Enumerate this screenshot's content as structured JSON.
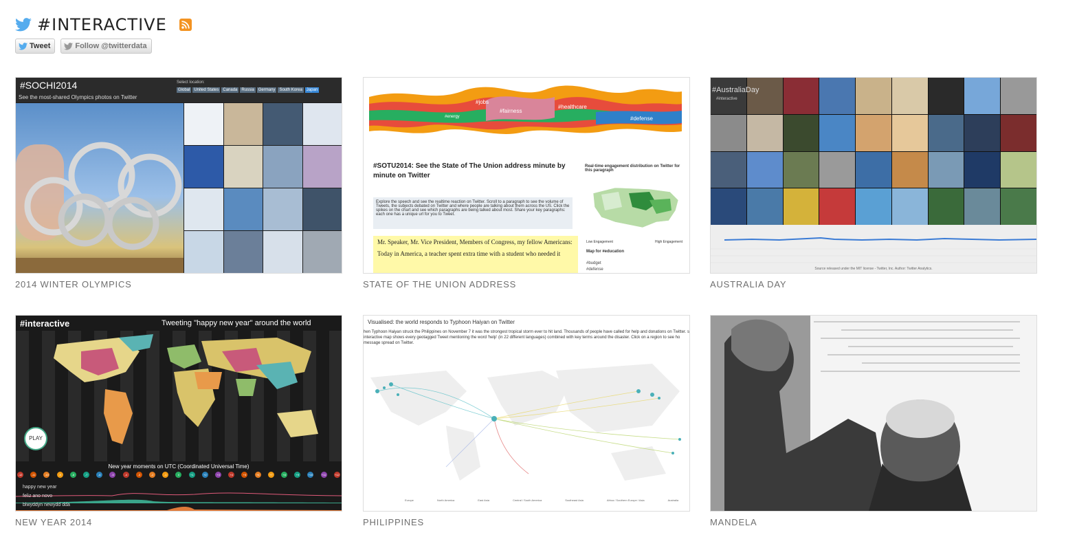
{
  "header": {
    "title": "#INTERACTIVE",
    "tweet_label": "Tweet",
    "follow_label": "Follow @twitterdata",
    "icons": [
      "twitter-bird-icon",
      "rss-icon"
    ],
    "colors": {
      "twitter_blue": "#55acee",
      "rss_orange": "#f39322"
    }
  },
  "cards": [
    {
      "caption": "2014 WINTER OLYMPICS",
      "thumb": {
        "hashtag": "#SOCHI2014",
        "subtitle": "See the most-shared Olympics photos on Twitter",
        "select_label": "Select location:",
        "locations": [
          "Global",
          "United States",
          "Canada",
          "Russia",
          "Germany",
          "South Korea",
          "Japan"
        ]
      }
    },
    {
      "caption": "STATE OF THE UNION ADDRESS",
      "thumb": {
        "stream_labels": [
          "#jobs",
          "#energy",
          "#fairness",
          "#healthcare",
          "#defense"
        ],
        "headline": "#SOTU2014: See the State of The Union address minute by minute on Twitter",
        "realtime": "Real-time engagement distribution on Twitter for this paragraph",
        "description": "Explore the speech and see the realtime reaction on Twitter. Scroll to a paragraph to see the volume of Tweets, the subjects debated on Twitter and where people are talking about them across the US. Click the spikes on the chart and see which paragraphs are being talked about most. Share your key paragraphs: each one has a unique url for you to Tweet.",
        "speech_1": "Mr. Speaker, Mr. Vice President, Members of Congress, my fellow Americans:",
        "speech_2": "Today in America, a teacher spent extra time with a student who needed it",
        "low_label": "Low Engagement",
        "high_label": "High Engagement",
        "map_for": "Map for #education",
        "tags": [
          "#budget",
          "#defense"
        ]
      }
    },
    {
      "caption": "AUSTRALIA DAY",
      "thumb": {
        "hashtag": "#AustraliaDay",
        "sub": "#interactive",
        "source": "Source released under the MIT license - Twitter, Inc. Author: Twitter Analytics."
      }
    },
    {
      "caption": "NEW YEAR 2014",
      "thumb": {
        "hashtag": "#interactive",
        "title": "Tweeting \"happy new year\" around the world",
        "play": "PLAY",
        "utc": "New year moments on UTC (Coordinated Universal Time)",
        "offsets": [
          "-12",
          "-11",
          "-10",
          "-9",
          "-8",
          "-7",
          "-6",
          "-5",
          "-4",
          "-3",
          "-2",
          "-1",
          "0",
          "+1",
          "+2",
          "+3",
          "+4",
          "+5",
          "+6",
          "+7",
          "+8",
          "+9",
          "+10",
          "+11",
          "+12"
        ],
        "phrases": [
          "happy new year",
          "feliz ano novo",
          "blwyddyn newydd dda"
        ]
      }
    },
    {
      "caption": "PHILIPPINES",
      "thumb": {
        "title": "Visualised: the world responds to Typhoon Haiyan on Twitter",
        "para": "hen Typhoon Haiyan struck the Philippines on November 7 it was the strongest tropical storm ever to hit land. Thousands of people have called for help and donations on Twitter. s interactive map shows every geotagged Tweet mentioning the word 'help' (in 22 different languages) combined with key terms around the disaster. Click on a region to see ho message spread on Twitter.",
        "legend": [
          "Europe",
          "North America",
          "East Asia",
          "Central / South America",
          "Southeast Asia",
          "Africa / Southern Europe / Asia",
          "Australia"
        ]
      }
    },
    {
      "caption": "MANDELA",
      "thumb": {}
    }
  ]
}
